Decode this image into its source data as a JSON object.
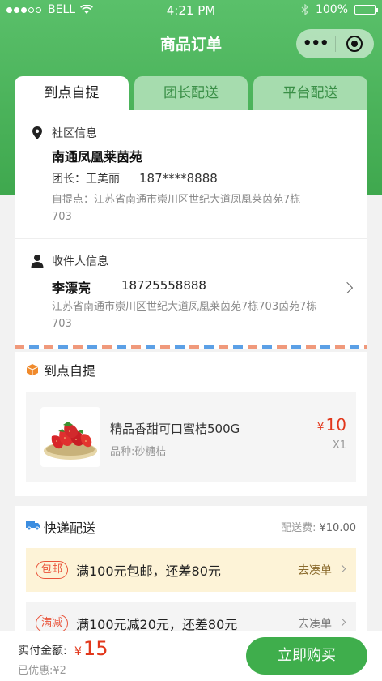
{
  "status_bar": {
    "carrier": "BELL",
    "time": "4:21 PM",
    "battery": "100%"
  },
  "nav": {
    "title": "商品订单",
    "more_label": "•••"
  },
  "tabs": [
    {
      "label": "到点自提",
      "active": true
    },
    {
      "label": "团长配送",
      "active": false
    },
    {
      "label": "平台配送",
      "active": false
    }
  ],
  "community": {
    "title": "社区信息",
    "name": "南通凤凰莱茵苑",
    "leader_label": "团长：王美丽",
    "leader_phone": "187****8888",
    "pickup_point": "自提点：江苏省南通市崇川区世纪大道凤凰莱茵苑7栋703"
  },
  "receiver": {
    "title": "收件人信息",
    "name": "李漂亮",
    "phone": "18725558888",
    "address": "江苏省南通市崇川区世纪大道凤凰莱茵苑7栋703茵苑7栋703"
  },
  "pickup_section": {
    "title": "到点自提",
    "product": {
      "name": "精品香甜可口蜜桔500G",
      "spec": "品种:砂糖桔",
      "currency": "¥",
      "price": "10",
      "qty": "X1"
    }
  },
  "express_section": {
    "title": "快递配送",
    "fee_label": "配送费:",
    "fee_value": "¥10.00",
    "promos": [
      {
        "tag": "包邮",
        "text": "满100元包邮，还差80元",
        "action": "去凑单"
      },
      {
        "tag": "满减",
        "text": "满100元减20元，还差80元",
        "action": "去凑单"
      }
    ]
  },
  "bottom": {
    "pay_label": "实付金额:",
    "currency": "¥",
    "amount": "15",
    "discount": "已优惠:¥2",
    "buy_label": "立即购买"
  },
  "colors": {
    "brand_green": "#3fae4c",
    "price_red": "#e2371b",
    "tab_inactive": "#a6dcae"
  }
}
